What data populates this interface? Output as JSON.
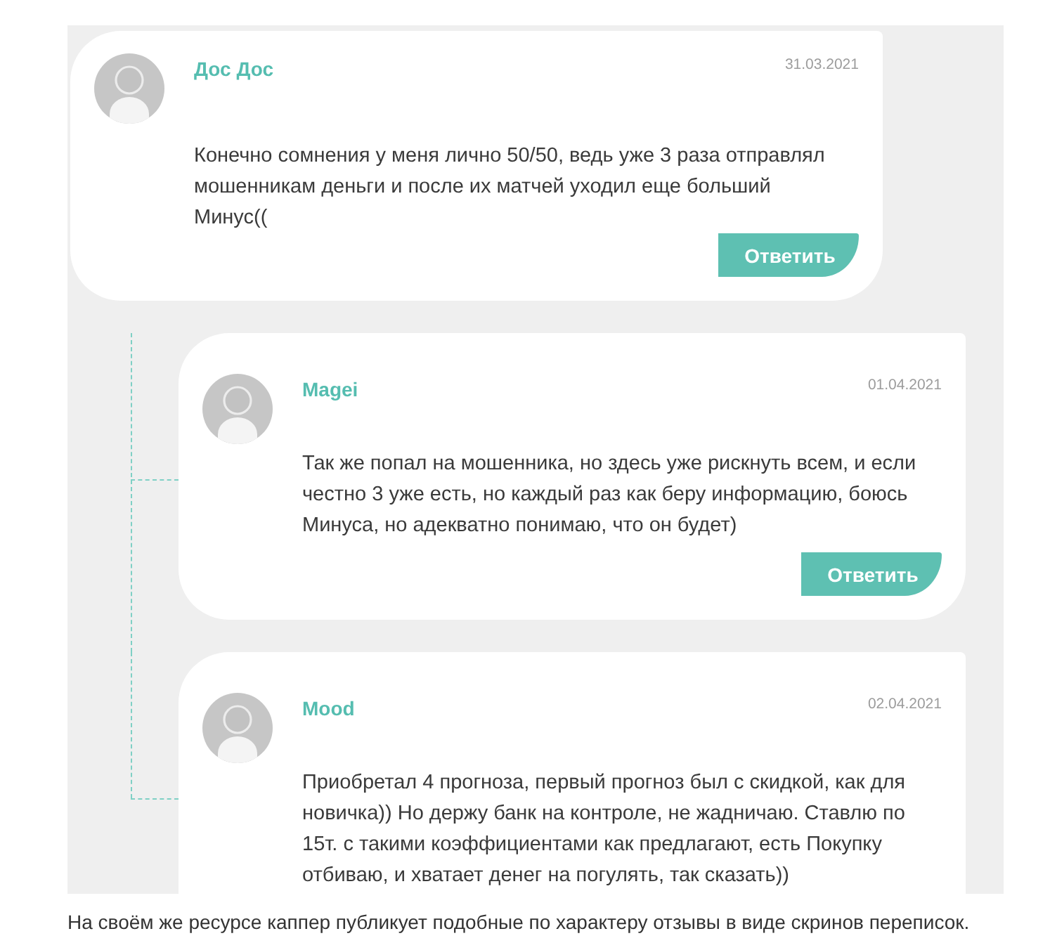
{
  "comments": [
    {
      "author": "Дос Дос",
      "date": "31.03.2021",
      "text": "Конечно сомнения у меня лично 50/50, ведь уже 3 раза отправлял мошенникам деньги и после их матчей уходил еще больший Минус((",
      "reply_label": "Ответить",
      "children": [
        {
          "author": "Magei",
          "date": "01.04.2021",
          "text": "Так же попал на мошенника, но здесь уже рискнуть всем, и если честно 3 уже есть, но каждый раз как беру информацию, боюсь Минуса, но адекватно понимаю, что он будет)",
          "reply_label": "Ответить"
        },
        {
          "author": "Mood",
          "date": "02.04.2021",
          "text": "Приобретал 4 прогноза, первый прогноз был с скидкой, как для новичка)) Но держу банк на контроле, не жадничаю. Ставлю по 15т. с такими коэффициентами как предлагают, есть Покупку отбиваю, и хватает денег на погулять, так сказать))"
        }
      ]
    }
  ],
  "caption": "На своём же ресурсе каппер публикует подобные по характеру отзывы в виде скринов переписок."
}
